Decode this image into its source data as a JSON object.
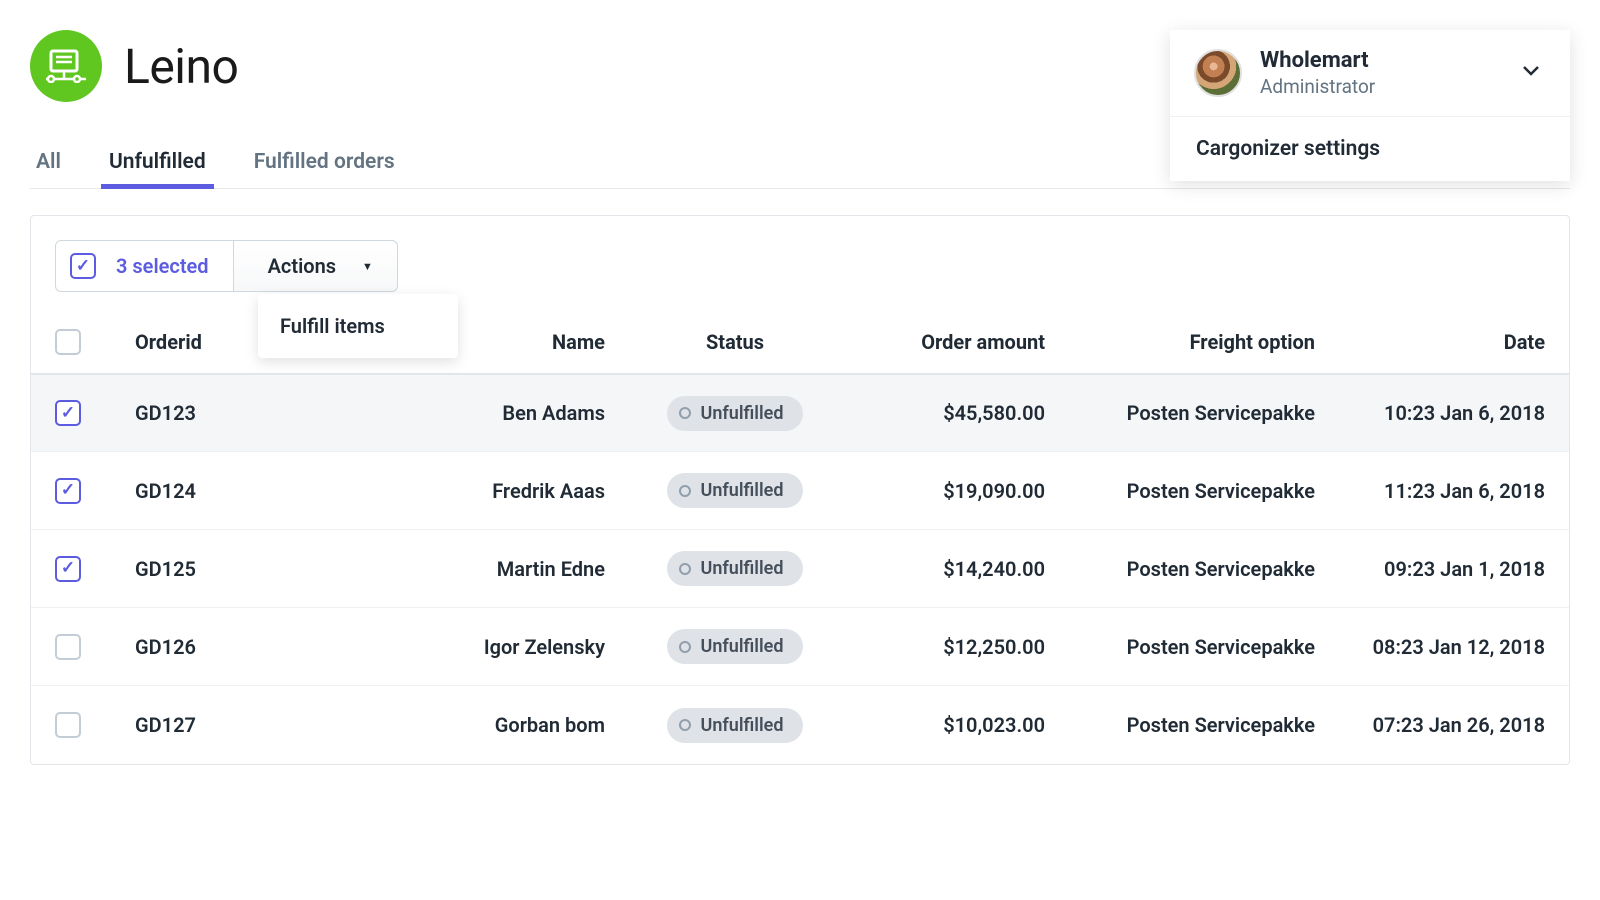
{
  "app": {
    "name": "Leino"
  },
  "user": {
    "org": "Wholemart",
    "role": "Administrator",
    "menu": {
      "settings": "Cargonizer settings"
    }
  },
  "tabs": [
    {
      "label": "All",
      "active": false
    },
    {
      "label": "Unfulfilled",
      "active": true
    },
    {
      "label": "Fulfilled orders",
      "active": false
    }
  ],
  "toolbar": {
    "selected_label": "3 selected",
    "actions_label": "Actions",
    "actions_menu": {
      "fulfill": "Fulfill items"
    }
  },
  "columns": {
    "orderid": "Orderid",
    "name": "Name",
    "status": "Status",
    "amount": "Order amount",
    "freight": "Freight option",
    "date": "Date"
  },
  "rows": [
    {
      "checked": true,
      "orderid": "GD123",
      "name": "Ben Adams",
      "status": "Unfulfilled",
      "amount": "$45,580.00",
      "freight": "Posten Servicepakke",
      "date": "10:23 Jan 6, 2018"
    },
    {
      "checked": true,
      "orderid": "GD124",
      "name": "Fredrik Aaas",
      "status": "Unfulfilled",
      "amount": "$19,090.00",
      "freight": "Posten Servicepakke",
      "date": "11:23 Jan 6, 2018"
    },
    {
      "checked": true,
      "orderid": "GD125",
      "name": "Martin Edne",
      "status": "Unfulfilled",
      "amount": "$14,240.00",
      "freight": "Posten Servicepakke",
      "date": "09:23 Jan 1, 2018"
    },
    {
      "checked": false,
      "orderid": "GD126",
      "name": "Igor Zelensky",
      "status": "Unfulfilled",
      "amount": "$12,250.00",
      "freight": "Posten Servicepakke",
      "date": "08:23 Jan 12, 2018"
    },
    {
      "checked": false,
      "orderid": "GD127",
      "name": "Gorban bom",
      "status": "Unfulfilled",
      "amount": "$10,023.00",
      "freight": "Posten Servicepakke",
      "date": "07:23 Jan 26, 2018"
    }
  ]
}
